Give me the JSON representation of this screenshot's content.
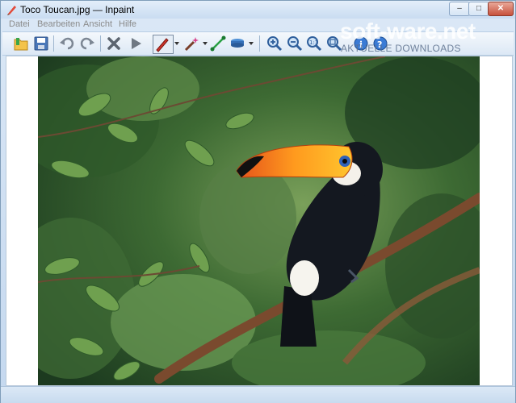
{
  "window": {
    "title": "Toco Toucan.jpg — Inpaint",
    "min_label": "–",
    "max_label": "□",
    "close_label": "✕"
  },
  "menu": {
    "items": [
      {
        "label": "Datei"
      },
      {
        "label": "Bearbeiten"
      },
      {
        "label": "Ansicht"
      },
      {
        "label": "Hilfe"
      }
    ]
  },
  "toolbar": {
    "tools": [
      "open-icon",
      "save-icon",
      "undo-icon",
      "redo-icon",
      "erase-icon",
      "play-icon",
      "marker-icon",
      "magic-wand-icon",
      "line-icon",
      "layers-icon",
      "zoom-in-icon",
      "zoom-out-icon",
      "zoom-actual-icon",
      "zoom-fit-icon",
      "info-icon",
      "help-icon"
    ]
  },
  "watermark": {
    "brand": "soft-ware.net",
    "sub": "AKTUELLE DOWNLOADS"
  },
  "colors": {
    "accent": "#3a7bd5",
    "toucan_beak": "#ff8a1e"
  }
}
